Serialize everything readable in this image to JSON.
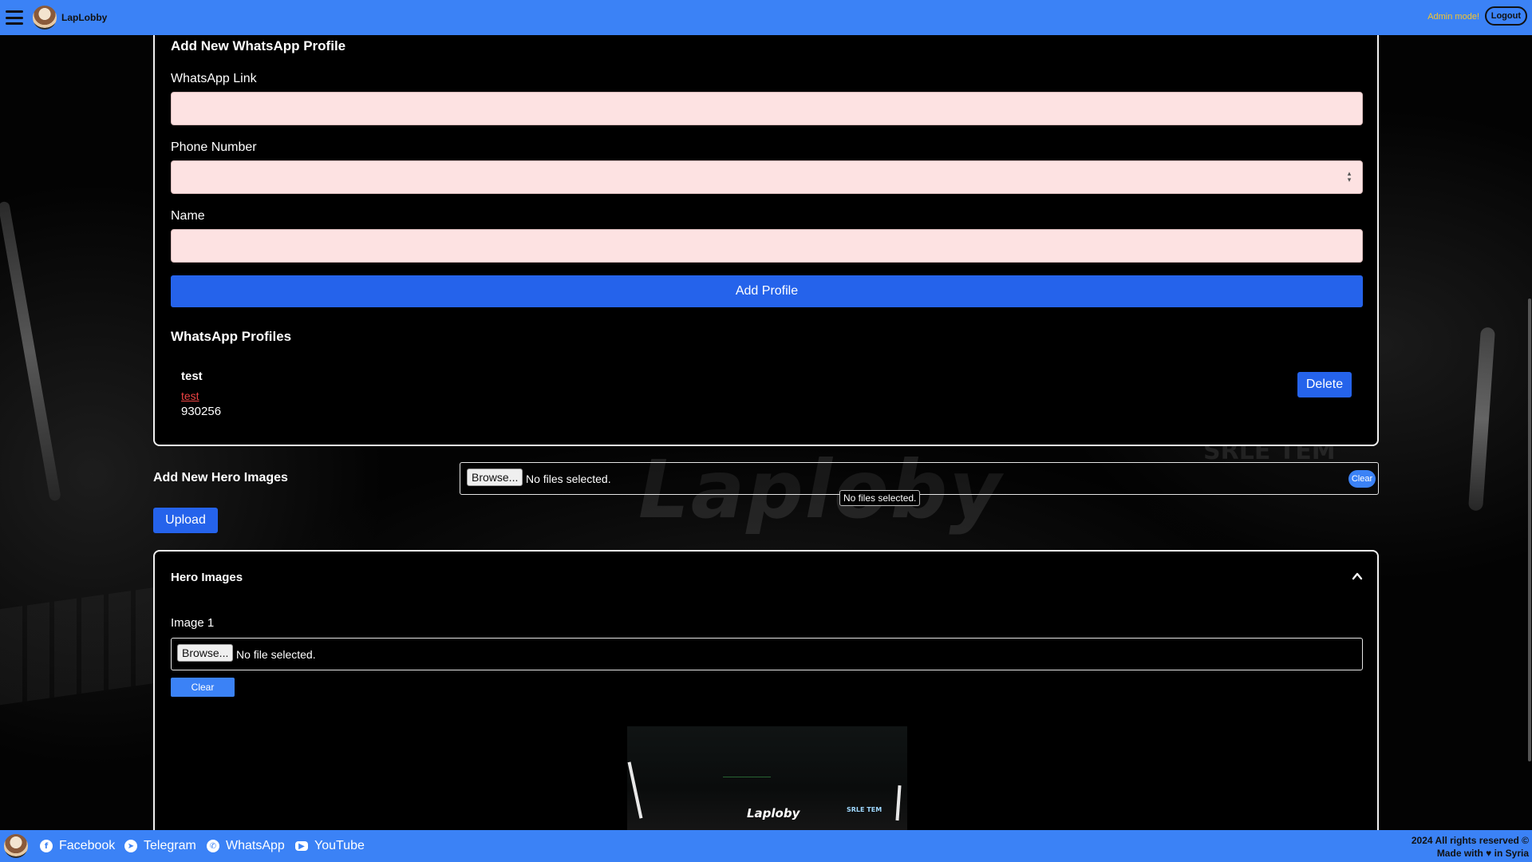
{
  "header": {
    "brand": "LapLobby",
    "admin_mode": "Admin mode!",
    "logout": "Logout"
  },
  "whatsapp_form": {
    "title": "Add New WhatsApp Profile",
    "link_label": "WhatsApp Link",
    "link_value": "",
    "phone_label": "Phone Number",
    "phone_value": "",
    "name_label": "Name",
    "name_value": "",
    "add_button": "Add Profile"
  },
  "profiles": {
    "title": "WhatsApp Profiles",
    "items": [
      {
        "name": "test",
        "link": "test",
        "phone": "930256",
        "delete_label": "Delete"
      }
    ]
  },
  "hero_upload": {
    "label": "Add New Hero Images",
    "browse_label": "Browse...",
    "status": "No files selected.",
    "clear_label": "Clear",
    "tooltip": "No files selected.",
    "upload_label": "Upload"
  },
  "hero_images": {
    "title": "Hero Images",
    "images": [
      {
        "label": "Image 1",
        "browse_label": "Browse...",
        "status": "No file selected.",
        "clear_label": "Clear",
        "preview_logo_text": "Laploby",
        "preview_sign_text": "SRLE TEM"
      }
    ]
  },
  "background": {
    "watermark": "Laploby",
    "sign": "SRLE TEM"
  },
  "footer": {
    "links": [
      {
        "label": "Facebook",
        "icon": "facebook-icon"
      },
      {
        "label": "Telegram",
        "icon": "telegram-icon"
      },
      {
        "label": "WhatsApp",
        "icon": "whatsapp-icon"
      },
      {
        "label": "YouTube",
        "icon": "youtube-icon"
      }
    ],
    "copyright": "2024 All rights reserved ©",
    "made_with_prefix": "Made with",
    "made_with_suffix": "in Syria"
  },
  "colors": {
    "header_bg": "#3b82f6",
    "primary_button": "#2563eb",
    "input_bg": "#fde2e2",
    "admin_mode_text": "#f7c52a",
    "link_text": "#ef4444"
  }
}
